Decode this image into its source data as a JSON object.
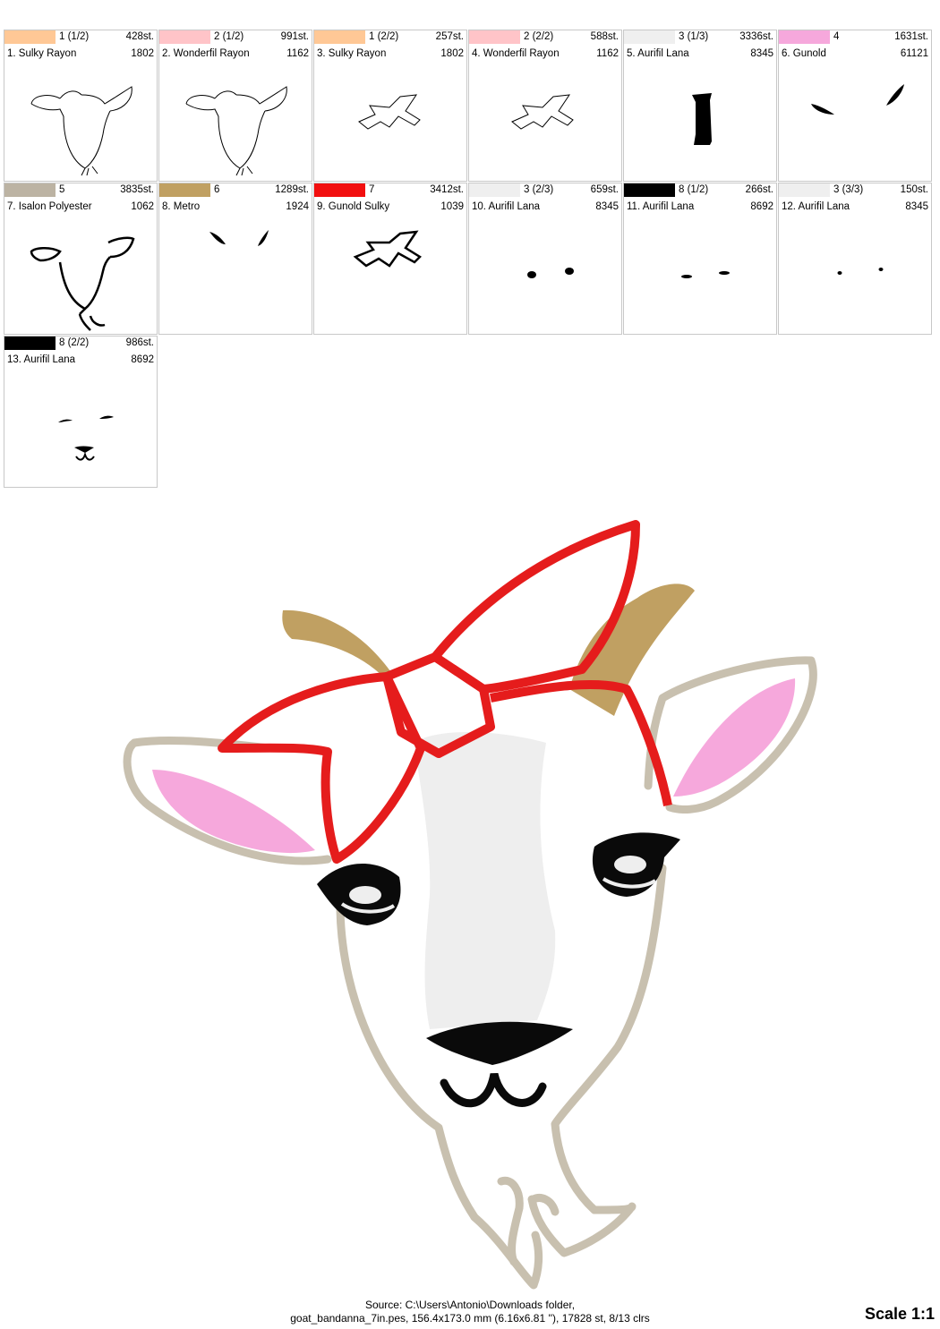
{
  "colorways": [
    {
      "color_num": "1 (1/2)",
      "stitches": "428st.",
      "name": "1. Sulky Rayon",
      "code": "1802",
      "swatch": "#ffc896"
    },
    {
      "color_num": "2 (1/2)",
      "stitches": "991st.",
      "name": "2. Wonderfil Rayon",
      "code": "1162",
      "swatch": "#ffc4c8"
    },
    {
      "color_num": "1 (2/2)",
      "stitches": "257st.",
      "name": "3. Sulky Rayon",
      "code": "1802",
      "swatch": "#ffc896"
    },
    {
      "color_num": "2 (2/2)",
      "stitches": "588st.",
      "name": "4. Wonderfil Rayon",
      "code": "1162",
      "swatch": "#ffc4c8"
    },
    {
      "color_num": "3 (1/3)",
      "stitches": "3336st.",
      "name": "5. Aurifil Lana",
      "code": "8345",
      "swatch": "#efefef"
    },
    {
      "color_num": "4",
      "stitches": "1631st.",
      "name": "6. Gunold",
      "code": "61121",
      "swatch": "#f6a8dc"
    },
    {
      "color_num": "5",
      "stitches": "3835st.",
      "name": "7. Isalon Polyester",
      "code": "1062",
      "swatch": "#bcb3a3"
    },
    {
      "color_num": "6",
      "stitches": "1289st.",
      "name": "8. Metro",
      "code": "1924",
      "swatch": "#c0a062"
    },
    {
      "color_num": "7",
      "stitches": "3412st.",
      "name": "9. Gunold Sulky",
      "code": "1039",
      "swatch": "#f20f0f"
    },
    {
      "color_num": "3 (2/3)",
      "stitches": "659st.",
      "name": "10. Aurifil Lana",
      "code": "8345",
      "swatch": "#efefef"
    },
    {
      "color_num": "8 (1/2)",
      "stitches": "266st.",
      "name": "11. Aurifil Lana",
      "code": "8692",
      "swatch": "#000000"
    },
    {
      "color_num": "3 (3/3)",
      "stitches": "150st.",
      "name": "12. Aurifil Lana",
      "code": "8345",
      "swatch": "#efefef"
    },
    {
      "color_num": "8 (2/2)",
      "stitches": "986st.",
      "name": "13. Aurifil Lana",
      "code": "8692",
      "swatch": "#000000"
    }
  ],
  "footer": {
    "line1": "Source: C:\\Users\\Antonio\\Downloads folder,",
    "line2": "goat_bandanna_7in.pes, 156.4x173.0 mm (6.16x6.81 ''), 17828 st, 8/13 clrs"
  },
  "scale": "Scale 1:1",
  "colors": {
    "tan": "#c8c0af",
    "pink": "#f6a8dc",
    "horn": "#c0a062",
    "red": "#e51c1c",
    "white": "#eeeeee",
    "black": "#0a0a0a"
  }
}
